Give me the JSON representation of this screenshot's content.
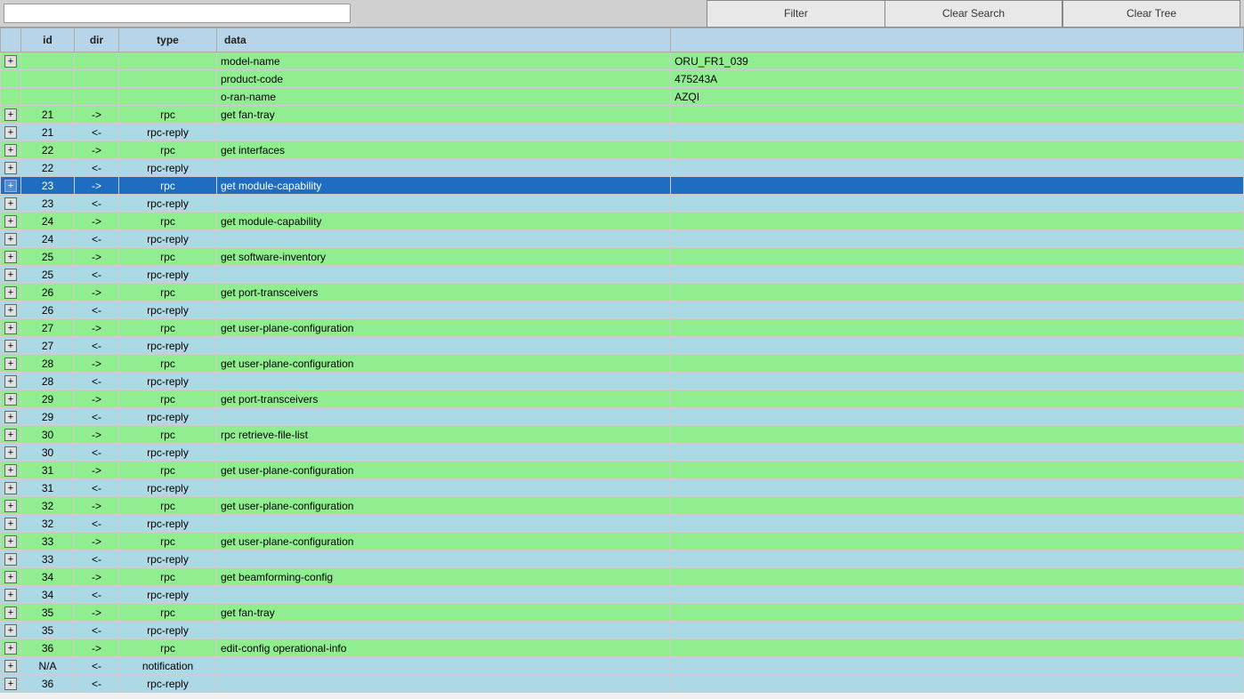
{
  "toolbar": {
    "search_placeholder": "",
    "filter_label": "Filter",
    "clear_search_label": "Clear Search",
    "clear_tree_label": "Clear Tree"
  },
  "table": {
    "headers": [
      "",
      "id",
      "dir",
      "type",
      "data",
      ""
    ],
    "rows": [
      {
        "rowtype": "green",
        "expand": "+",
        "id": "",
        "dir": "",
        "type": "",
        "data": "model-name",
        "value": "ORU_FR1_039"
      },
      {
        "rowtype": "green",
        "expand": "",
        "id": "",
        "dir": "",
        "type": "",
        "data": "product-code",
        "value": "475243A"
      },
      {
        "rowtype": "green",
        "expand": "",
        "id": "",
        "dir": "",
        "type": "",
        "data": "o-ran-name",
        "value": "AZQI"
      },
      {
        "rowtype": "green",
        "expand": "+",
        "id": "21",
        "dir": "->",
        "type": "rpc",
        "data": "get fan-tray",
        "value": ""
      },
      {
        "rowtype": "light-blue",
        "expand": "+",
        "id": "21",
        "dir": "<-",
        "type": "rpc-reply",
        "data": "",
        "value": ""
      },
      {
        "rowtype": "green",
        "expand": "+",
        "id": "22",
        "dir": "->",
        "type": "rpc",
        "data": "get interfaces",
        "value": ""
      },
      {
        "rowtype": "light-blue",
        "expand": "+",
        "id": "22",
        "dir": "<-",
        "type": "rpc-reply",
        "data": "",
        "value": ""
      },
      {
        "rowtype": "selected",
        "expand": "+",
        "id": "23",
        "dir": "->",
        "type": "rpc",
        "data": "get module-capability",
        "value": ""
      },
      {
        "rowtype": "light-blue",
        "expand": "+",
        "id": "23",
        "dir": "<-",
        "type": "rpc-reply",
        "data": "",
        "value": ""
      },
      {
        "rowtype": "green",
        "expand": "+",
        "id": "24",
        "dir": "->",
        "type": "rpc",
        "data": "get module-capability",
        "value": ""
      },
      {
        "rowtype": "light-blue",
        "expand": "+",
        "id": "24",
        "dir": "<-",
        "type": "rpc-reply",
        "data": "",
        "value": ""
      },
      {
        "rowtype": "green",
        "expand": "+",
        "id": "25",
        "dir": "->",
        "type": "rpc",
        "data": "get software-inventory",
        "value": ""
      },
      {
        "rowtype": "light-blue",
        "expand": "+",
        "id": "25",
        "dir": "<-",
        "type": "rpc-reply",
        "data": "",
        "value": ""
      },
      {
        "rowtype": "green",
        "expand": "+",
        "id": "26",
        "dir": "->",
        "type": "rpc",
        "data": "get port-transceivers",
        "value": ""
      },
      {
        "rowtype": "light-blue",
        "expand": "+",
        "id": "26",
        "dir": "<-",
        "type": "rpc-reply",
        "data": "",
        "value": ""
      },
      {
        "rowtype": "green",
        "expand": "+",
        "id": "27",
        "dir": "->",
        "type": "rpc",
        "data": "get user-plane-configuration",
        "value": ""
      },
      {
        "rowtype": "light-blue",
        "expand": "+",
        "id": "27",
        "dir": "<-",
        "type": "rpc-reply",
        "data": "",
        "value": ""
      },
      {
        "rowtype": "green",
        "expand": "+",
        "id": "28",
        "dir": "->",
        "type": "rpc",
        "data": "get user-plane-configuration",
        "value": ""
      },
      {
        "rowtype": "light-blue",
        "expand": "+",
        "id": "28",
        "dir": "<-",
        "type": "rpc-reply",
        "data": "",
        "value": ""
      },
      {
        "rowtype": "green",
        "expand": "+",
        "id": "29",
        "dir": "->",
        "type": "rpc",
        "data": "get port-transceivers",
        "value": ""
      },
      {
        "rowtype": "light-blue",
        "expand": "+",
        "id": "29",
        "dir": "<-",
        "type": "rpc-reply",
        "data": "",
        "value": ""
      },
      {
        "rowtype": "green",
        "expand": "+",
        "id": "30",
        "dir": "->",
        "type": "rpc",
        "data": "rpc retrieve-file-list",
        "value": ""
      },
      {
        "rowtype": "light-blue",
        "expand": "+",
        "id": "30",
        "dir": "<-",
        "type": "rpc-reply",
        "data": "",
        "value": ""
      },
      {
        "rowtype": "green",
        "expand": "+",
        "id": "31",
        "dir": "->",
        "type": "rpc",
        "data": "get user-plane-configuration",
        "value": ""
      },
      {
        "rowtype": "light-blue",
        "expand": "+",
        "id": "31",
        "dir": "<-",
        "type": "rpc-reply",
        "data": "",
        "value": ""
      },
      {
        "rowtype": "green",
        "expand": "+",
        "id": "32",
        "dir": "->",
        "type": "rpc",
        "data": "get user-plane-configuration",
        "value": ""
      },
      {
        "rowtype": "light-blue",
        "expand": "+",
        "id": "32",
        "dir": "<-",
        "type": "rpc-reply",
        "data": "",
        "value": ""
      },
      {
        "rowtype": "green",
        "expand": "+",
        "id": "33",
        "dir": "->",
        "type": "rpc",
        "data": "get user-plane-configuration",
        "value": ""
      },
      {
        "rowtype": "light-blue",
        "expand": "+",
        "id": "33",
        "dir": "<-",
        "type": "rpc-reply",
        "data": "",
        "value": ""
      },
      {
        "rowtype": "green",
        "expand": "+",
        "id": "34",
        "dir": "->",
        "type": "rpc",
        "data": "get beamforming-config",
        "value": ""
      },
      {
        "rowtype": "light-blue",
        "expand": "+",
        "id": "34",
        "dir": "<-",
        "type": "rpc-reply",
        "data": "",
        "value": ""
      },
      {
        "rowtype": "green",
        "expand": "+",
        "id": "35",
        "dir": "->",
        "type": "rpc",
        "data": "get fan-tray",
        "value": ""
      },
      {
        "rowtype": "light-blue",
        "expand": "+",
        "id": "35",
        "dir": "<-",
        "type": "rpc-reply",
        "data": "",
        "value": ""
      },
      {
        "rowtype": "green",
        "expand": "+",
        "id": "36",
        "dir": "->",
        "type": "rpc",
        "data": "edit-config operational-info",
        "value": ""
      },
      {
        "rowtype": "light-blue",
        "expand": "+",
        "id": "N/A",
        "dir": "<-",
        "type": "notification",
        "data": "",
        "value": ""
      },
      {
        "rowtype": "light-blue",
        "expand": "+",
        "id": "36",
        "dir": "<-",
        "type": "rpc-reply",
        "data": "",
        "value": ""
      }
    ]
  }
}
